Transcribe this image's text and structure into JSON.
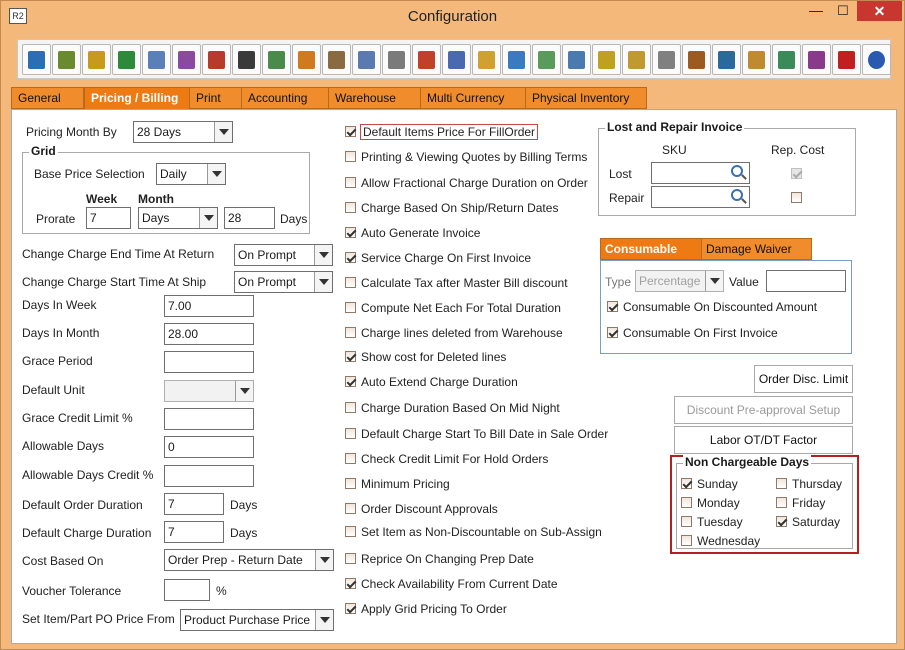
{
  "window": {
    "title": "Configuration",
    "app_icon": "R2"
  },
  "toolbar": {
    "icons": [
      "save-icon",
      "config-icon",
      "coins-icon",
      "dollar-icon",
      "edit-icon",
      "report-icon",
      "pay-icon",
      "grid-icon",
      "notes-icon",
      "transfer-icon",
      "calendar-icon",
      "triangle-icon",
      "gear-icon",
      "colors-icon",
      "brush-icon",
      "folder-icon",
      "card-icon",
      "doc-check-icon",
      "doc-arrow-icon",
      "funnel-icon",
      "funnel-gear-icon",
      "process-icon",
      "network-icon",
      "user-icon",
      "folder-gear-icon",
      "calculator-icon",
      "export-icon",
      "exit-icon",
      "help-icon"
    ]
  },
  "tabs": [
    "General",
    "Pricing / Billing",
    "Print",
    "Accounting",
    "Warehouse",
    "Multi Currency",
    "Physical Inventory"
  ],
  "left": {
    "pricing_month_by_label": "Pricing Month By",
    "pricing_month_by_value": "28 Days",
    "grid_title": "Grid",
    "base_price_label": "Base Price Selection",
    "base_price_value": "Daily",
    "week_label": "Week",
    "month_label": "Month",
    "prorate_label": "Prorate",
    "prorate_week": "7",
    "prorate_month_unit": "Days",
    "prorate_days": "28",
    "days_label": "Days",
    "change_end_label": "Change Charge End Time At Return",
    "change_end_value": "On Prompt",
    "change_start_label": "Change Charge Start Time At Ship",
    "change_start_value": "On Prompt",
    "days_in_week_label": "Days In Week",
    "days_in_week_value": "7.00",
    "days_in_month_label": "Days In Month",
    "days_in_month_value": "28.00",
    "grace_period_label": "Grace Period",
    "grace_period_value": "",
    "default_unit_label": "Default Unit",
    "default_unit_value": "",
    "grace_credit_label": "Grace Credit Limit %",
    "grace_credit_value": "",
    "allowable_days_label": "Allowable Days",
    "allowable_days_value": "0",
    "allowable_credit_label": "Allowable Days Credit %",
    "allowable_credit_value": "",
    "default_order_duration_label": "Default Order Duration",
    "default_order_duration_value": "7",
    "default_order_duration_unit": "Days",
    "default_charge_duration_label": "Default Charge Duration",
    "default_charge_duration_value": "7",
    "default_charge_duration_unit": "Days",
    "cost_based_on_label": "Cost Based On",
    "cost_based_on_value": "Order Prep - Return Date",
    "voucher_tolerance_label": "Voucher Tolerance",
    "voucher_tolerance_value": "",
    "voucher_tolerance_unit": "%",
    "po_price_from_label": "Set Item/Part PO Price From",
    "po_price_from_value": "Product Purchase Price"
  },
  "middle_checks": [
    {
      "label": "Default Items Price For FillOrder",
      "checked": true
    },
    {
      "label": "Printing & Viewing Quotes by Billing Terms",
      "checked": false
    },
    {
      "label": "Allow Fractional Charge Duration on Order",
      "checked": false
    },
    {
      "label": "Charge Based On Ship/Return Dates",
      "checked": false
    },
    {
      "label": "Auto Generate Invoice",
      "checked": true
    },
    {
      "label": "Service Charge On First Invoice",
      "checked": true
    },
    {
      "label": "Calculate Tax after Master Bill discount",
      "checked": false
    },
    {
      "label": "Compute Net Each For Total Duration",
      "checked": false
    },
    {
      "label": "Charge lines deleted from Warehouse",
      "checked": false
    },
    {
      "label": "Show cost for Deleted lines",
      "checked": true
    },
    {
      "label": "Auto Extend Charge Duration",
      "checked": true
    },
    {
      "label": "Charge Duration Based On Mid Night",
      "checked": false
    },
    {
      "label": "Default Charge Start To Bill Date in Sale Order",
      "checked": false
    },
    {
      "label": "Check Credit Limit For Hold Orders",
      "checked": false
    },
    {
      "label": "Minimum Pricing",
      "checked": false
    },
    {
      "label": "Order Discount Approvals",
      "checked": false
    },
    {
      "label": "Set Item as Non-Discountable on Sub-Assign",
      "checked": false
    },
    {
      "label": "Reprice On Changing Prep Date",
      "checked": false
    },
    {
      "label": "Check Availability From Current Date",
      "checked": true
    },
    {
      "label": "Apply Grid Pricing To Order",
      "checked": true
    }
  ],
  "lost_repair": {
    "title": "Lost and Repair Invoice",
    "sku_header": "SKU",
    "rep_cost_header": "Rep. Cost",
    "lost_label": "Lost",
    "lost_value": "",
    "repair_label": "Repair",
    "repair_value": ""
  },
  "consumable": {
    "tab_consumable": "Consumable",
    "tab_damage": "Damage Waiver",
    "type_label": "Type",
    "type_value": "Percentage",
    "value_label": "Value",
    "value_value": "",
    "discounted_label": "Consumable On Discounted Amount",
    "first_invoice_label": "Consumable On First Invoice"
  },
  "buttons": {
    "order_disc_limit": "Order Disc. Limit",
    "discount_preapproval": "Discount Pre-approval Setup",
    "labor_factor": "Labor OT/DT Factor"
  },
  "non_chargeable": {
    "title": "Non Chargeable Days",
    "days": [
      {
        "label": "Sunday",
        "checked": true
      },
      {
        "label": "Thursday",
        "checked": false
      },
      {
        "label": "Monday",
        "checked": false
      },
      {
        "label": "Friday",
        "checked": false
      },
      {
        "label": "Tuesday",
        "checked": false
      },
      {
        "label": "Saturday",
        "checked": true
      },
      {
        "label": "Wednesday",
        "checked": false
      }
    ]
  },
  "colors": {
    "accent": "#ee7a14",
    "highlight_border": "#b41f24"
  }
}
